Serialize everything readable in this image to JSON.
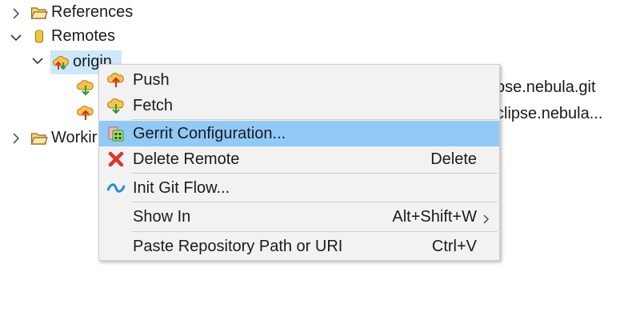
{
  "tree": {
    "references_label": "References",
    "remotes_label": "Remotes",
    "origin_label": "origin",
    "fetch_url_partial": "ose.nebula.git",
    "push_url_partial": "clipse.nebula...",
    "working_label_partial": "Workir"
  },
  "icons": {
    "collapsed": "chevron-right-icon",
    "expanded": "chevron-down-icon",
    "folder": "folder-icon",
    "remotes": "remotes-cylinder-icon",
    "remote": "remote-cloud-icon",
    "push": "push-icon",
    "fetch": "fetch-icon",
    "gerrit": "gerrit-icon",
    "delete": "delete-x-icon",
    "gitflow": "git-flow-wave-icon"
  },
  "colors": {
    "selection": "#cce8ff",
    "menu_highlight": "#91c9f7",
    "menu_background": "#f2f2f2",
    "delete_red": "#d8372f",
    "gitflow_blue": "#1e8fe0"
  },
  "menu": {
    "push": "Push",
    "fetch": "Fetch",
    "gerrit": "Gerrit Configuration...",
    "delete_remote": "Delete Remote",
    "delete_shortcut": "Delete",
    "init_git_flow": "Init Git Flow...",
    "show_in": "Show In",
    "show_in_shortcut": "Alt+Shift+W",
    "paste_path": "Paste Repository Path or URI",
    "paste_shortcut": "Ctrl+V"
  }
}
